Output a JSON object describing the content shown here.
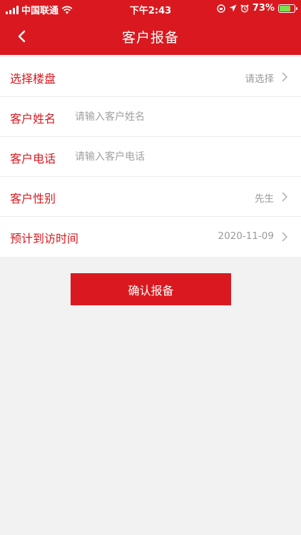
{
  "status_bar": {
    "carrier": "中国联通",
    "time": "下午2:43",
    "battery": "73%",
    "battery_level": 0.73
  },
  "header": {
    "title": "客户报备"
  },
  "form": {
    "building": {
      "label": "选择楼盘",
      "value": "请选择"
    },
    "name": {
      "label": "客户姓名",
      "placeholder": "请输入客户姓名"
    },
    "phone": {
      "label": "客户电话",
      "placeholder": "请输入客户电话"
    },
    "gender": {
      "label": "客户性别",
      "value": "先生"
    },
    "visit_time": {
      "label": "预计到访时间",
      "value": "2020-11-09"
    }
  },
  "confirm_label": "确认报备",
  "colors": {
    "brand": "#d9191f",
    "background": "#f2f2f2",
    "battery": "#7ee04d"
  }
}
